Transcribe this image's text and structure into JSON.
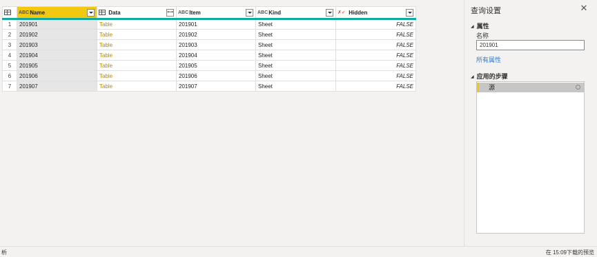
{
  "grid": {
    "columns": [
      {
        "type_icon": "ABC",
        "label": "Name"
      },
      {
        "type_icon": "table",
        "label": "Data"
      },
      {
        "type_icon": "ABC",
        "label": "Item"
      },
      {
        "type_icon": "ABC",
        "label": "Kind"
      },
      {
        "type_icon": "✗✓",
        "label": "Hidden"
      }
    ],
    "rows": [
      {
        "num": "1",
        "name": "201901",
        "data": "Table",
        "item": "201901",
        "kind": "Sheet",
        "hidden": "FALSE"
      },
      {
        "num": "2",
        "name": "201902",
        "data": "Table",
        "item": "201902",
        "kind": "Sheet",
        "hidden": "FALSE"
      },
      {
        "num": "3",
        "name": "201903",
        "data": "Table",
        "item": "201903",
        "kind": "Sheet",
        "hidden": "FALSE"
      },
      {
        "num": "4",
        "name": "201904",
        "data": "Table",
        "item": "201904",
        "kind": "Sheet",
        "hidden": "FALSE"
      },
      {
        "num": "5",
        "name": "201905",
        "data": "Table",
        "item": "201905",
        "kind": "Sheet",
        "hidden": "FALSE"
      },
      {
        "num": "6",
        "name": "201906",
        "data": "Table",
        "item": "201906",
        "kind": "Sheet",
        "hidden": "FALSE"
      },
      {
        "num": "7",
        "name": "201907",
        "data": "Table",
        "item": "201907",
        "kind": "Sheet",
        "hidden": "FALSE"
      }
    ],
    "expand_icon": "⟷"
  },
  "pane": {
    "title": "查询设置",
    "close_glyph": "✕",
    "properties_heading": "属性",
    "name_label": "名称",
    "name_value": "201901",
    "all_properties_link": "所有属性",
    "applied_steps_heading": "应用的步骤",
    "steps": [
      "源"
    ]
  },
  "status": {
    "left": "析",
    "right": "在 15:09下载的预览"
  },
  "colors": {
    "name_header": "#f2c811",
    "header_underline": "#13a89e",
    "table_value": "#b58a00",
    "link": "#2b7bd6"
  }
}
